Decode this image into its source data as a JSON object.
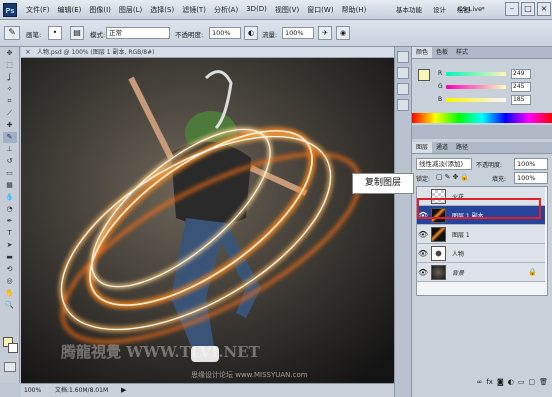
{
  "app": {
    "logo": "Ps",
    "menus": [
      "文件(F)",
      "编辑(E)",
      "图像(I)",
      "图层(L)",
      "选择(S)",
      "滤镜(T)",
      "分析(A)",
      "3D(D)",
      "视图(V)",
      "窗口(W)",
      "帮助(H)"
    ],
    "zoom_field": "100%",
    "workspace": [
      "基本功能",
      "设计",
      "绘画"
    ],
    "cs_live": "CS Live"
  },
  "options": {
    "mode_label": "模式:",
    "mode_value": "正常",
    "opacity_label": "不透明度:",
    "opacity_value": "100%",
    "flow_label": "流量:",
    "flow_value": "100%"
  },
  "document": {
    "tab_title": "人物.psd @ 100% (图层 1 副本, RGB/8#)",
    "zoom": "100%",
    "status": "文档:1.60M/8.01M"
  },
  "color_panel": {
    "channels": [
      {
        "name": "R",
        "value": "249"
      },
      {
        "name": "G",
        "value": "245"
      },
      {
        "name": "B",
        "value": "185"
      }
    ],
    "swatch_color": "#f9f5b9"
  },
  "layers_panel": {
    "tabs": [
      "图层",
      "通道",
      "路径"
    ],
    "blend_mode": "线性减淡(添加)",
    "opacity_label": "不透明度:",
    "opacity_value": "100%",
    "lock_label": "锁定:",
    "fill_label": "填充:",
    "fill_value": "100%",
    "layers": [
      {
        "name": "火花",
        "visible": false,
        "selected": false
      },
      {
        "name": "图层 1 副本",
        "visible": true,
        "selected": true
      },
      {
        "name": "图层 1",
        "visible": true,
        "selected": false
      },
      {
        "name": "人物",
        "visible": true,
        "selected": false
      },
      {
        "name": "背景",
        "visible": true,
        "selected": false
      }
    ]
  },
  "annotation": {
    "callout": "复制图层"
  },
  "watermark": {
    "line1": "腾龍視覺 WWW.TLVI.NET",
    "line2": "思缘设计论坛 www.MISSYUAN.com"
  },
  "colors": {
    "selected_layer": "#27439a",
    "highlight_box": "#e0202c"
  }
}
